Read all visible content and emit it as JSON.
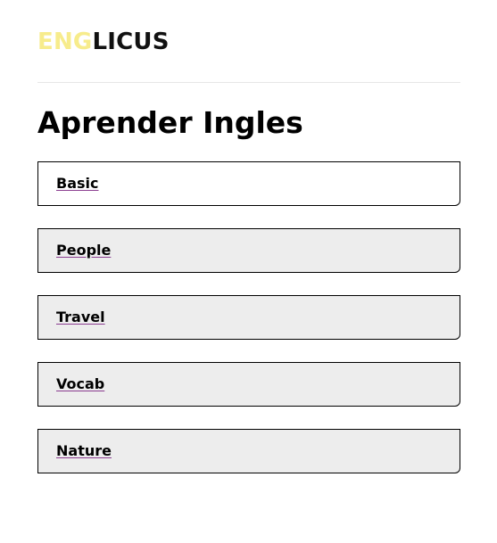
{
  "header": {
    "logo_part_a": "ENG",
    "logo_part_b": "LICUS"
  },
  "main": {
    "title": "Aprender Ingles",
    "items": [
      {
        "label": "Basic",
        "selected": true
      },
      {
        "label": "People",
        "selected": false
      },
      {
        "label": "Travel",
        "selected": false
      },
      {
        "label": "Vocab",
        "selected": false
      },
      {
        "label": "Nature",
        "selected": false
      }
    ]
  },
  "colors": {
    "logo_accent": "#f7ec8c",
    "logo_text": "#111111",
    "card_selected_bg": "#ffffff",
    "card_bg": "#ededed",
    "link_underline": "#8a3b8f"
  }
}
